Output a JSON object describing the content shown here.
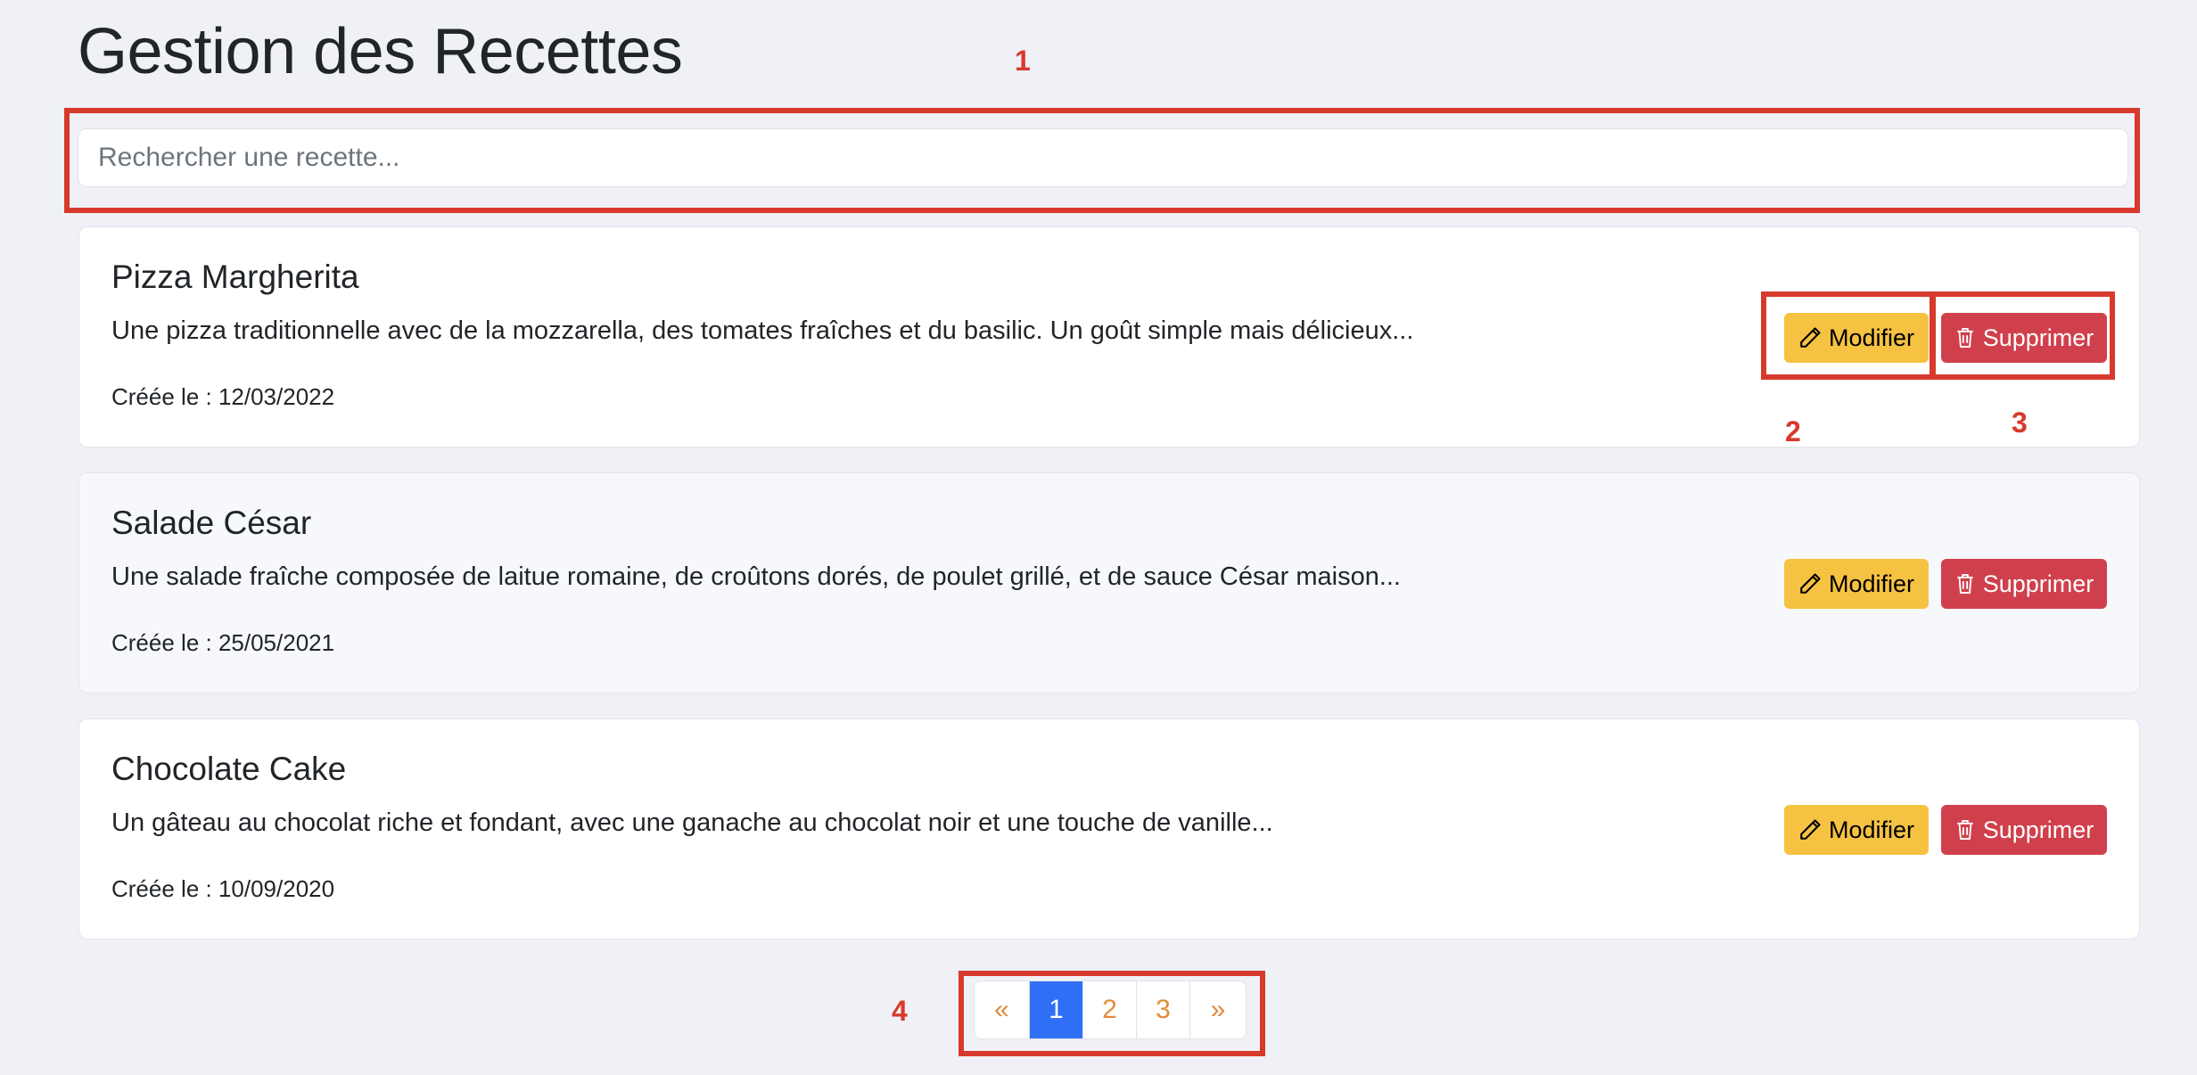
{
  "page": {
    "title": "Gestion des Recettes"
  },
  "search": {
    "placeholder": "Rechercher une recette...",
    "value": ""
  },
  "recipes": [
    {
      "title": "Pizza Margherita",
      "description": "Une pizza traditionnelle avec de la mozzarella, des tomates fraîches et du basilic. Un goût simple mais délicieux...",
      "date": "Créée le : 12/03/2022",
      "edit_label": "Modifier",
      "delete_label": "Supprimer"
    },
    {
      "title": "Salade César",
      "description": "Une salade fraîche composée de laitue romaine, de croûtons dorés, de poulet grillé, et de sauce César maison...",
      "date": "Créée le : 25/05/2021",
      "edit_label": "Modifier",
      "delete_label": "Supprimer"
    },
    {
      "title": "Chocolate Cake",
      "description": "Un gâteau au chocolat riche et fondant, avec une ganache au chocolat noir et une touche de vanille...",
      "date": "Créée le : 10/09/2020",
      "edit_label": "Modifier",
      "delete_label": "Supprimer"
    }
  ],
  "pagination": {
    "prev": "«",
    "pages": [
      "1",
      "2",
      "3"
    ],
    "current": "1",
    "next": "»"
  },
  "annotations": {
    "labels": [
      "1",
      "2",
      "3",
      "4"
    ],
    "color": "#d73a2c"
  },
  "colors": {
    "edit_button": "#f5c242",
    "delete_button": "#d0404c",
    "active_page": "#2f6ff5",
    "page_link": "#e38a3b"
  }
}
